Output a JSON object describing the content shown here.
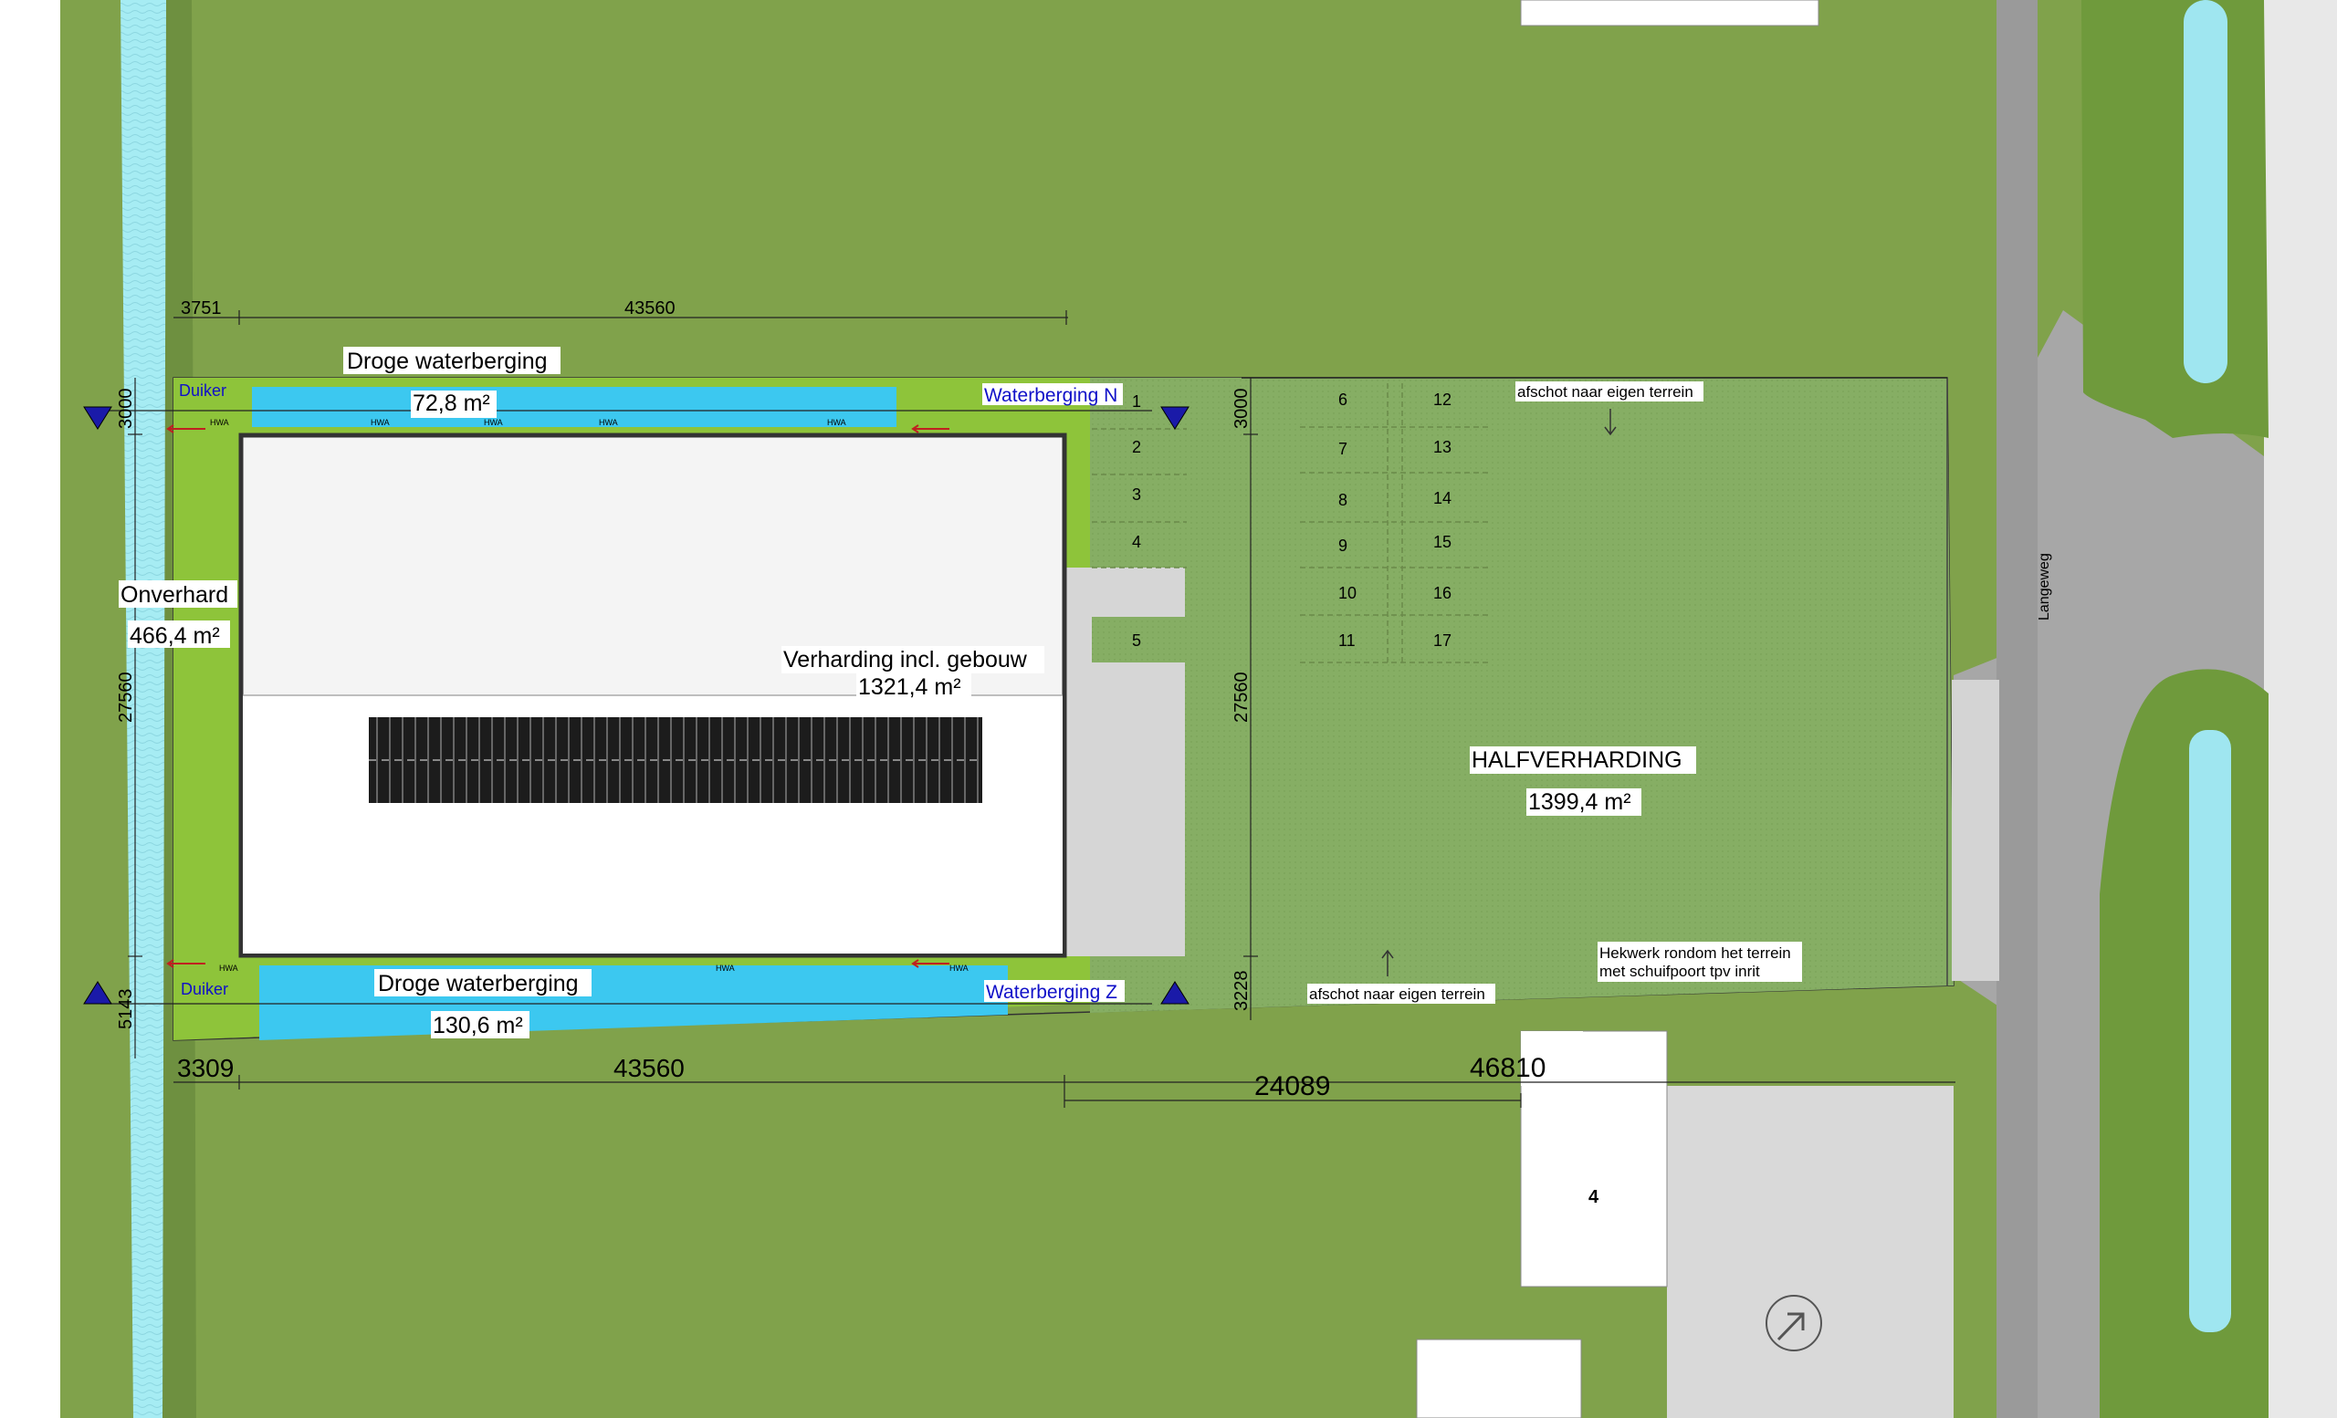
{
  "labels": {
    "droge_n": "Droge waterberging",
    "droge_n_area": "72,8 m²",
    "waterberging_n": "Waterberging N",
    "duiker_n": "Duiker",
    "onverhard": "Onverhard",
    "onverhard_area": "466,4 m²",
    "verharding": "Verharding incl. gebouw",
    "verharding_area": "1321,4 m²",
    "halfverharding": "HALFVERHARDING",
    "halfverharding_area": "1399,4 m²",
    "afschot_n": "afschot naar eigen terrein",
    "afschot_s": "afschot naar eigen terrein",
    "hekwerk_1": "Hekwerk rondom het terrein",
    "hekwerk_2": "met schuifpoort tpv inrit",
    "droge_s": "Droge waterberging",
    "droge_s_area": "130,6 m²",
    "waterberging_z": "Waterberging Z",
    "duiker_s": "Duiker",
    "road": "Langeweg",
    "plot_number": "4",
    "hwa": "HWA"
  },
  "dimensions": {
    "top_left": "3751",
    "top_main": "43560",
    "left_top": "3000",
    "left_mid": "27560",
    "left_bot": "5143",
    "mid_top": "3000",
    "mid_mid": "27560",
    "mid_bot": "3228",
    "bot_left": "3309",
    "bot_main": "43560",
    "bot_right": "24089",
    "bot_total": "46810"
  },
  "parking": {
    "col_a": [
      "1",
      "2",
      "3",
      "4",
      "5"
    ],
    "col_b": [
      "6",
      "7",
      "8",
      "9",
      "10",
      "11"
    ],
    "col_c": [
      "12",
      "13",
      "14",
      "15",
      "16",
      "17"
    ]
  },
  "colors": {
    "grass": "#80a24b",
    "grass_bright": "#8ec43a",
    "water": "#9fe6f0",
    "waterberging": "#3cc8f0",
    "halfverharding": "#85ad62",
    "pavement": "#d8d8d8",
    "road": "#9e9e9e",
    "building": "#f5f5f5",
    "markers": "#1a1aa8"
  }
}
